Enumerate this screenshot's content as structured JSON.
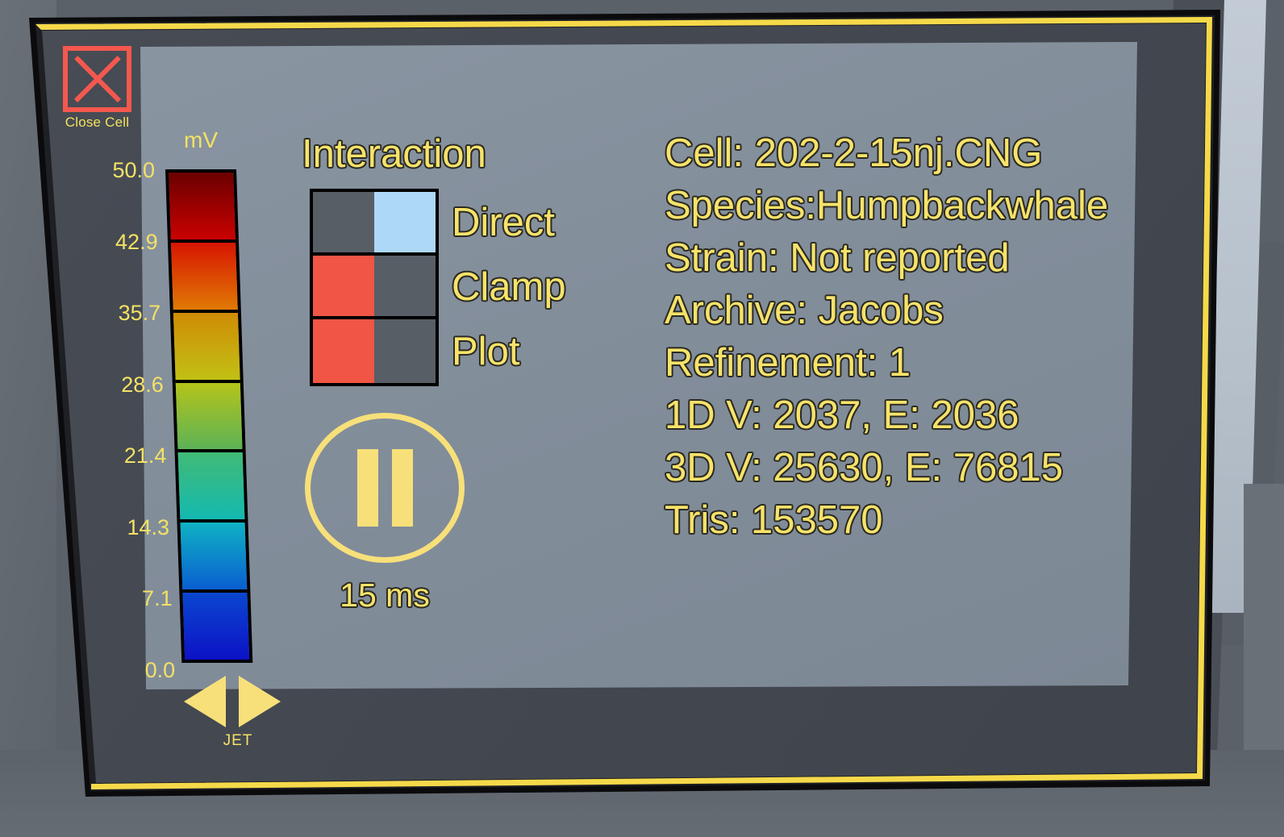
{
  "window": {
    "title": "Cell Viewer Panel",
    "accent_yellow": "#f7e36a",
    "frame_border": "#f5d94a",
    "panel_bg": "#454850",
    "screen_bg": "#828d9a"
  },
  "close_cell": {
    "label": "Close Cell",
    "icon": "close-x-icon",
    "color": "#f4584e"
  },
  "colorbar": {
    "unit_label": "mV",
    "colormap_name": "JET",
    "prev_icon": "arrow-left-icon",
    "next_icon": "arrow-right-icon",
    "ticks": [
      "50.0",
      "42.9",
      "35.7",
      "28.6",
      "21.4",
      "14.3",
      "7.1",
      "0.0"
    ],
    "segment_colors": [
      {
        "top": "#6b0000",
        "bottom": "#c90200"
      },
      {
        "top": "#d71500",
        "bottom": "#e07a05"
      },
      {
        "top": "#cf8c06",
        "bottom": "#c2c015"
      },
      {
        "top": "#b5c31a",
        "bottom": "#5cb356"
      },
      {
        "top": "#41bb76",
        "bottom": "#14b9b0"
      },
      {
        "top": "#0fb2c4",
        "bottom": "#0a5fd0"
      },
      {
        "top": "#0a47cf",
        "bottom": "#0d12c6"
      }
    ]
  },
  "interaction": {
    "title": "Interaction",
    "toggles": [
      {
        "label": "Direct",
        "state": "on",
        "left_color": "#575e66",
        "right_color": "#aed8f7"
      },
      {
        "label": "Clamp",
        "state": "off",
        "left_color": "#f05545",
        "right_color": "#575e66"
      },
      {
        "label": "Plot",
        "state": "off",
        "left_color": "#f05545",
        "right_color": "#575e66"
      }
    ]
  },
  "playback": {
    "icon": "pause-icon",
    "time_label": "15 ms"
  },
  "info": {
    "lines": [
      "Cell: 202-2-15nj.CNG",
      "Species:Humpbackwhale",
      "Strain: Not reported",
      "Archive: Jacobs",
      "Refinement: 1",
      "1D V: 2037, E: 2036",
      "3D V: 25630, E: 76815",
      "Tris: 153570"
    ]
  }
}
